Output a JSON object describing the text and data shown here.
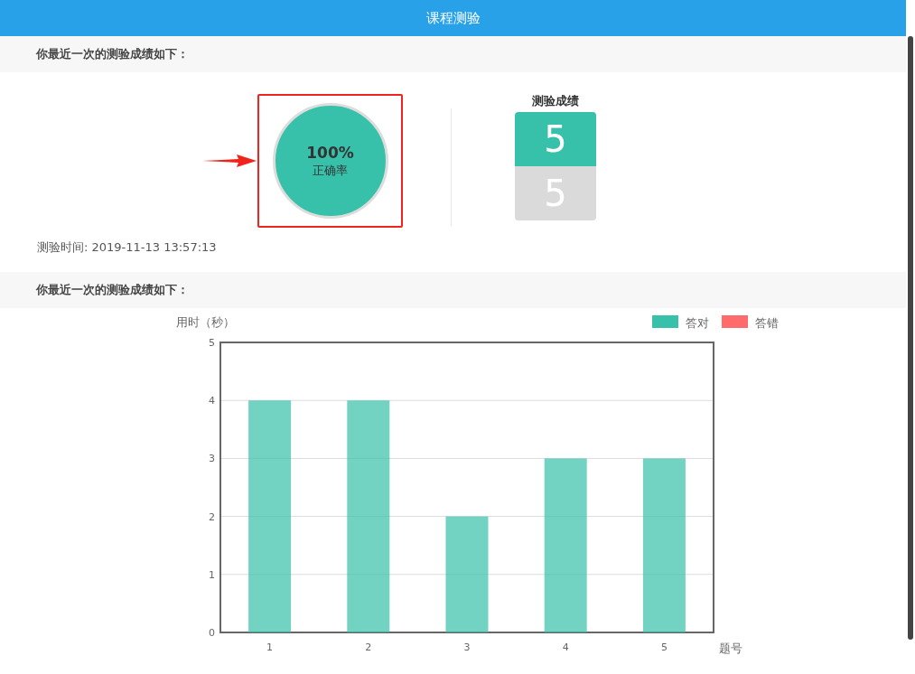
{
  "header": {
    "title": "课程测验"
  },
  "summary": {
    "heading": "你最近一次的测验成绩如下：",
    "accuracy": {
      "value": "100%",
      "label": "正确率",
      "highlighted": true
    },
    "score": {
      "title": "测验成绩",
      "correct": "5",
      "total": "5"
    },
    "time": "测验时间: 2019-11-13 13:57:13"
  },
  "chart_section": {
    "heading": "你最近一次的测验成绩如下：",
    "chart_data": {
      "type": "bar",
      "ylabel": "用时（秒）",
      "xlabel": "题号",
      "categories": [
        "1",
        "2",
        "3",
        "4",
        "5"
      ],
      "series": [
        {
          "name": "答对",
          "color": "#37c1aa",
          "values": [
            4,
            4,
            2,
            3,
            3
          ]
        },
        {
          "name": "答错",
          "color": "#ff6b6b",
          "values": [
            0,
            0,
            0,
            0,
            0
          ]
        }
      ],
      "grid": true,
      "ylim": [
        0,
        5
      ],
      "yticks": [
        0,
        1,
        2,
        3,
        4,
        5
      ]
    }
  }
}
